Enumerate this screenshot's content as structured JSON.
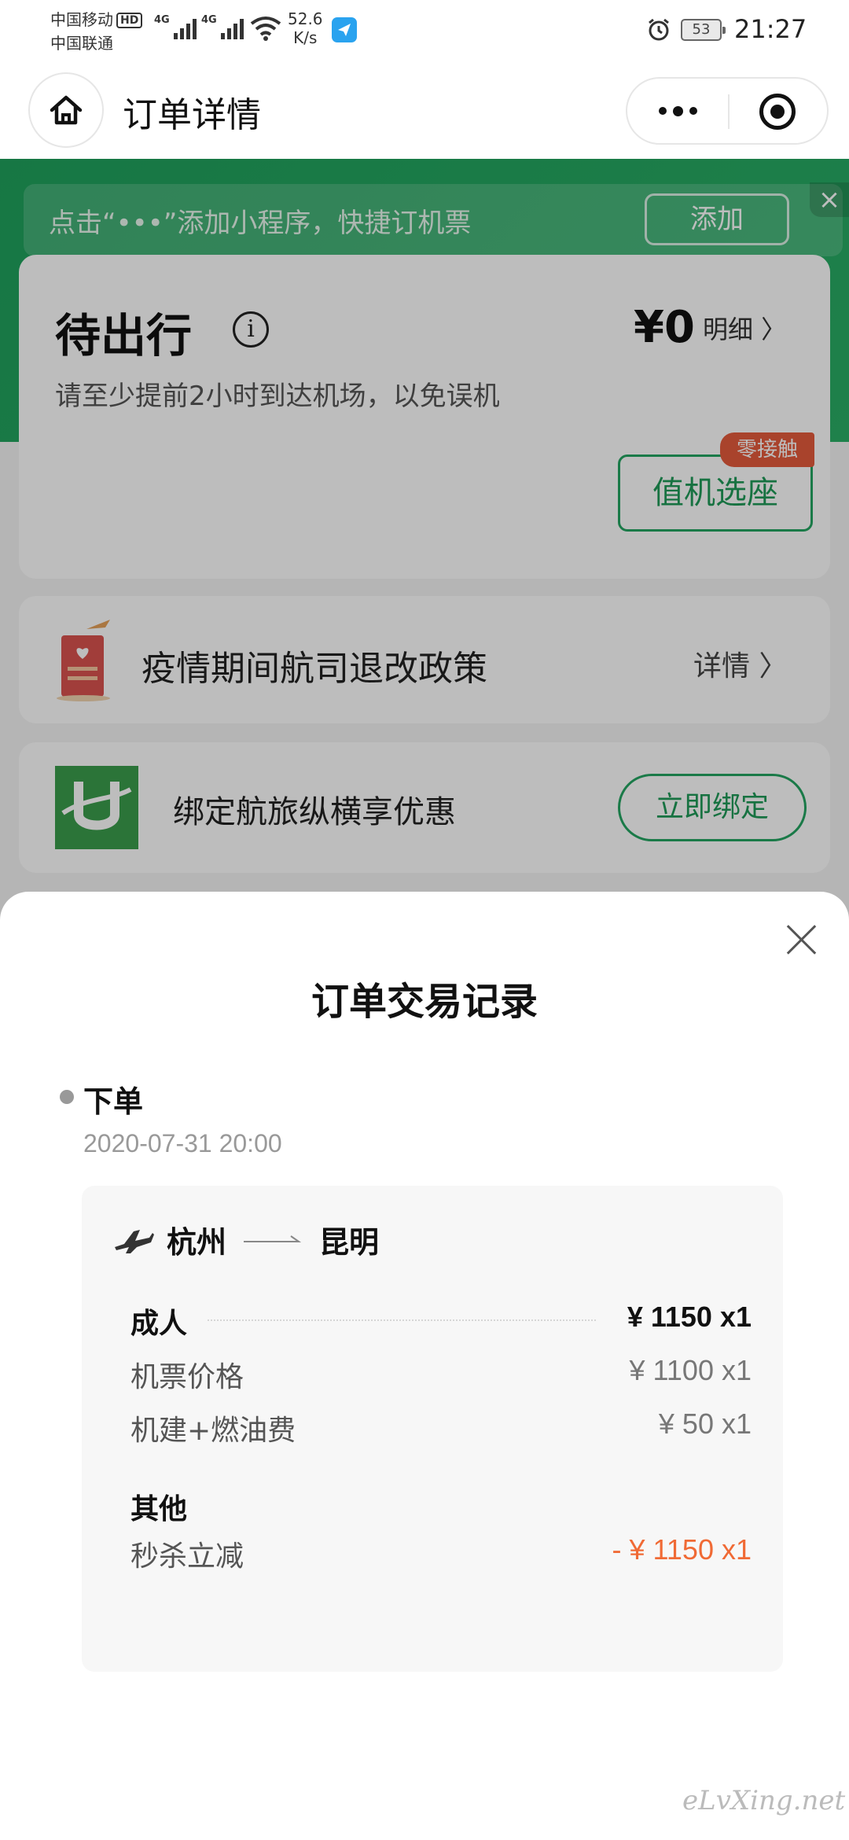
{
  "status_bar": {
    "carrier_1": "中国移动",
    "hd_badge": "HD",
    "carrier_2": "中国联通",
    "net_type_1": "4G",
    "net_type_2": "4G",
    "net_speed_value": "52.6",
    "net_speed_unit": "K/s",
    "battery": "53",
    "time": "21:27",
    "icons": [
      "signal-icon",
      "wifi-icon",
      "app-notification-icon",
      "alarm-icon",
      "battery-icon"
    ]
  },
  "nav": {
    "title": "订单详情",
    "home_icon": "home-icon",
    "more_icon": "more-dots-icon",
    "close_icon": "target-close-icon"
  },
  "add_tip": {
    "text": "点击“•••”添加小程序，快捷订机票",
    "button": "添加",
    "close": "×"
  },
  "status_card": {
    "title": "待出行",
    "info_glyph": "i",
    "price": "¥0",
    "detail_link": "明细 〉",
    "subtitle": "请至少提前2小时到达机场，以免误机",
    "badge": "零接触",
    "checkin_button": "值机选座"
  },
  "policy_card": {
    "text": "疫情期间航司退改政策",
    "link": "详情 〉"
  },
  "bind_card": {
    "text": "绑定航旅纵横享优惠",
    "button": "立即绑定"
  },
  "sheet": {
    "title": "订单交易记录",
    "timeline": {
      "label": "下单",
      "time": "2020-07-31 20:00"
    },
    "route": {
      "from": "杭州",
      "to": "昆明"
    },
    "adult": {
      "label": "成人",
      "value": "¥ 1150 x1",
      "items": [
        {
          "label": "机票价格",
          "value": "¥ 1100 x1"
        },
        {
          "label": "机建+燃油费",
          "value": "¥ 50 x1"
        }
      ]
    },
    "other": {
      "label": "其他",
      "items": [
        {
          "label": "秒杀立减",
          "value": "- ¥ 1150 x1"
        }
      ]
    }
  },
  "watermark": "eLvXing.net",
  "colors": {
    "brand_green": "#24a562",
    "discount_orange": "#f06a35",
    "badge_red": "#e55b3c"
  }
}
